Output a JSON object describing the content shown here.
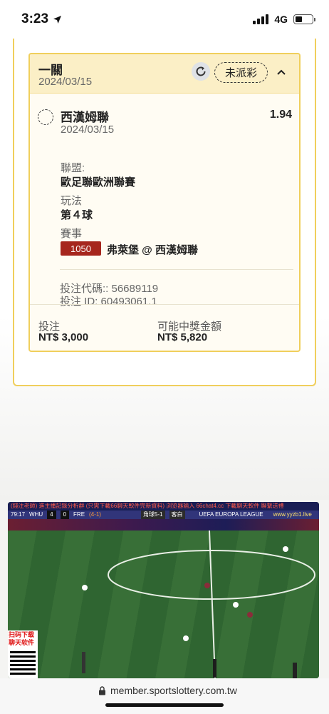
{
  "status_bar": {
    "time": "3:23",
    "network": "4G"
  },
  "bet_card": {
    "bet_type": "一關",
    "bet_date": "2024/03/15",
    "status": "未派彩",
    "selection": {
      "team": "西漢姆聯",
      "odds": "1.94",
      "date": "2024/03/15",
      "league_label": "聯盟:",
      "league_value": "歐足聯歐洲聯賽",
      "market_label": "玩法",
      "market_value": "第４球",
      "event_label": "賽事",
      "event_id": "1050",
      "event_name": "弗萊堡 @ 西漢姆聯",
      "bet_code": "投注代碼:: 56689119",
      "bet_id": "投注 ID: 60493061.1"
    },
    "totals": {
      "stake_label": "投注",
      "stake_value": "NT$ 3,000",
      "payout_label": "可能中獎金額",
      "payout_value": "NT$ 5,820"
    }
  },
  "video": {
    "ticker": "(錢注老師)  進主播記錄分析群  (只需下載66聊天軟件完新資料)  浏览器输入 66chat4.cc 下載聊天軟件 聯繫送禮",
    "match_time": "79:17",
    "home_team": "WHU",
    "home_score": "4",
    "away_score": "0",
    "away_team": "FRE",
    "agg_score": "(4-1)",
    "corner_info": "角球5-1",
    "side_info": "客白",
    "competition": "UEFA EUROPA LEAGUE",
    "site": "www.yyzb1.live",
    "qr_caption": "扫码下载 聊天软件"
  },
  "url_bar": {
    "domain": "member.sportslottery.com.tw"
  },
  "colors": {
    "accent_border": "#f0cf5c",
    "header_bg": "#fbefc6",
    "event_badge": "#a6261e"
  }
}
